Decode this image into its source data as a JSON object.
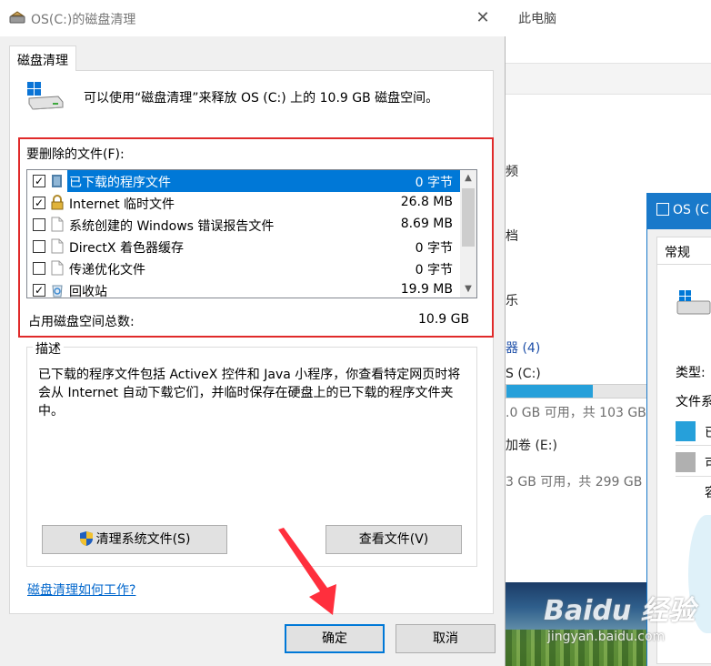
{
  "dialog": {
    "title": "OS(C:)的磁盘清理",
    "close_glyph": "✕",
    "tab": "磁盘清理",
    "intro": "可以使用“磁盘清理”来释放 OS (C:) 上的 10.9 GB 磁盘空间。",
    "files_label": "要删除的文件(F):",
    "files": [
      {
        "checked": true,
        "name": "已下载的程序文件",
        "size": "0 字节",
        "selected": true,
        "icon": "folder-icon"
      },
      {
        "checked": true,
        "name": "Internet 临时文件",
        "size": "26.8 MB",
        "selected": false,
        "icon": "lock-icon"
      },
      {
        "checked": false,
        "name": "系统创建的 Windows 错误报告文件",
        "size": "8.69 MB",
        "selected": false,
        "icon": "document-icon"
      },
      {
        "checked": false,
        "name": "DirectX 着色器缓存",
        "size": "0 字节",
        "selected": false,
        "icon": "document-icon"
      },
      {
        "checked": false,
        "name": "传递优化文件",
        "size": "0 字节",
        "selected": false,
        "icon": "document-icon"
      },
      {
        "checked": true,
        "name": "回收站",
        "size": "19.9 MB",
        "selected": false,
        "icon": "recycle-bin-icon"
      }
    ],
    "check_glyph": "✓",
    "total_label": "占用磁盘空间总数:",
    "total_value": "10.9 GB",
    "description_legend": "描述",
    "description": "已下载的程序文件包括 ActiveX 控件和 Java 小程序，你查看特定网页时将会从 Internet 自动下载它们，并临时保存在硬盘上的已下载的程序文件夹中。",
    "clean_system_button": "清理系统文件(S)",
    "view_files_button": "查看文件(V)",
    "help_link": "磁盘清理如何工作?",
    "ok_button": "确定",
    "cancel_button": "取消"
  },
  "explorer": {
    "title": "此电脑",
    "fragments": [
      "频",
      "档",
      "乐"
    ],
    "section": "器 (4)",
    "drive_c": "S (C:)",
    "drive_c_space": ".0 GB 可用，共 103 GB",
    "drive_c_used_fraction": 0.62,
    "drive_e": "加卷 (E:)",
    "drive_e_space": "3 GB 可用，共 299 GB"
  },
  "properties": {
    "title": "OS (C",
    "tab": "常规",
    "type_label": "类型:",
    "fs_label": "文件系",
    "used_label": "已",
    "free_label": "可",
    "capacity_label": "容"
  },
  "watermark": {
    "brand": "Baidu 经验",
    "url": "jingyan.baidu.com"
  },
  "colors": {
    "accent": "#0078d7",
    "highlight_box": "#e02a2a",
    "used": "#26a0da",
    "free": "#b0b0b0"
  }
}
